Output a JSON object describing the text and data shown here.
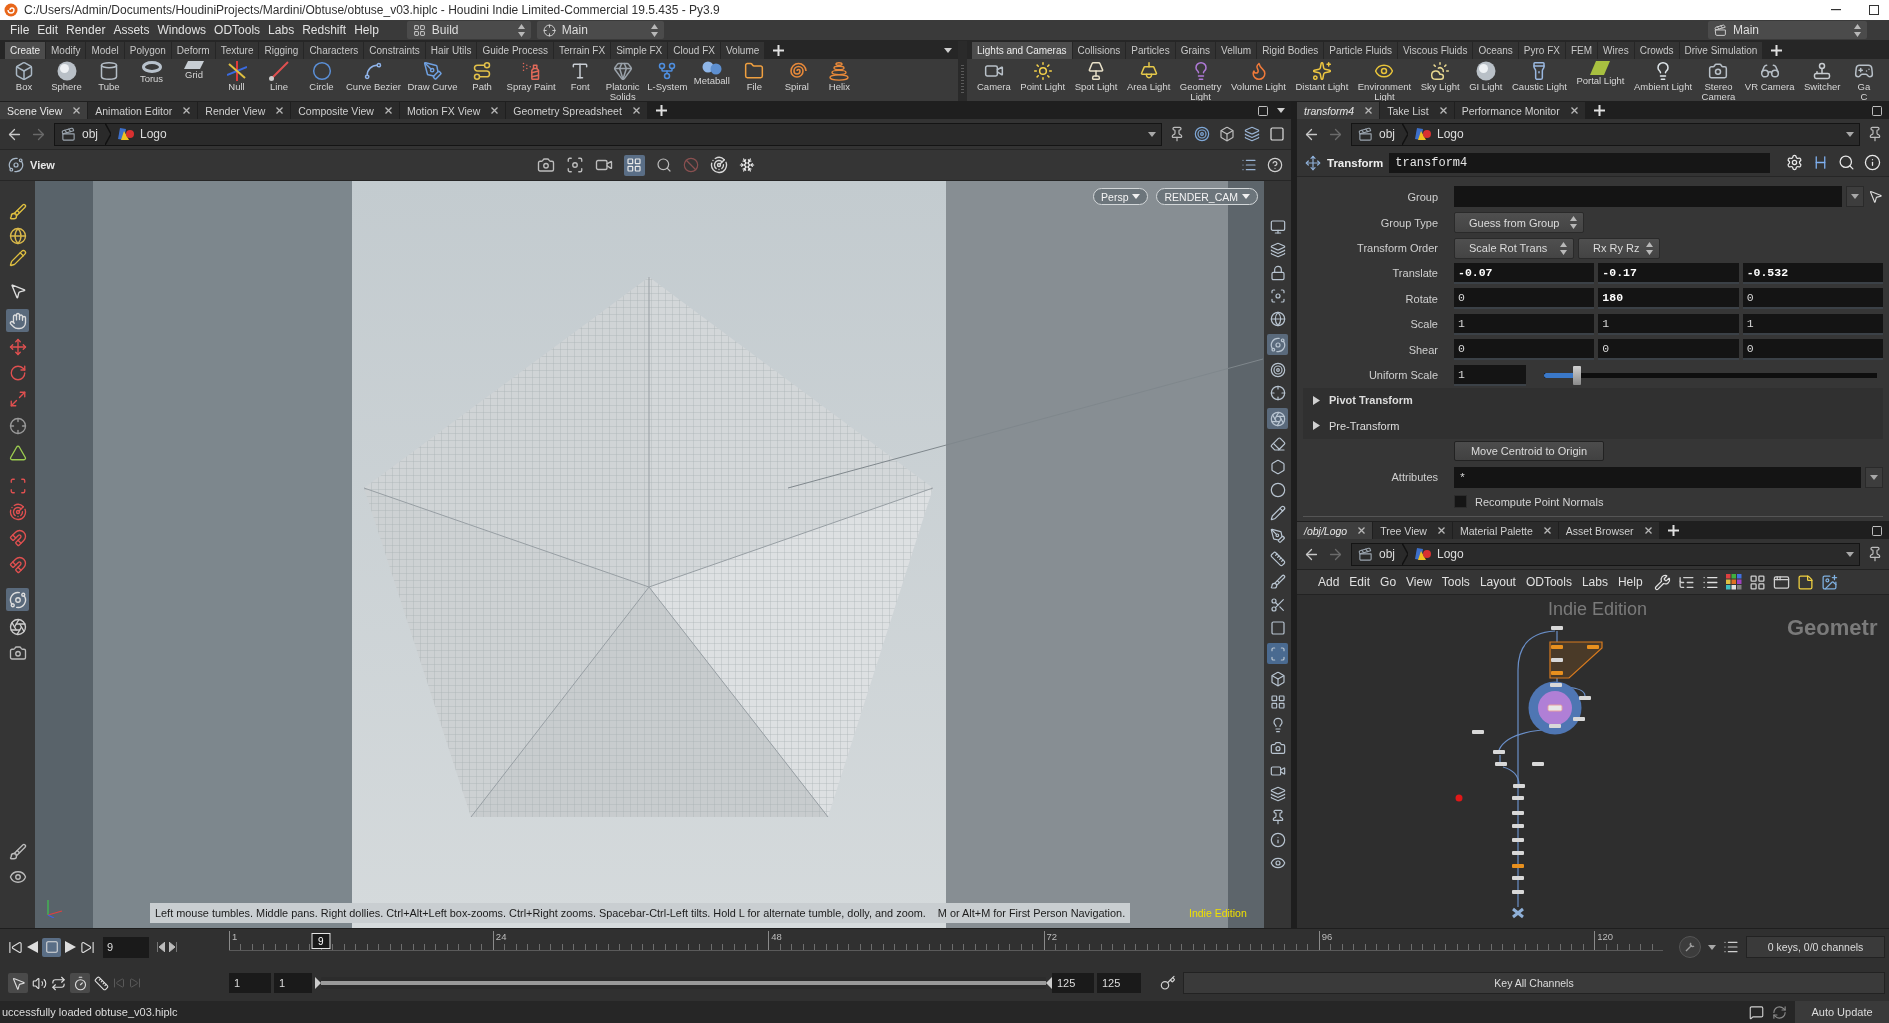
{
  "window": {
    "title": "C:/Users/Admin/Documents/HoudiniProjects/Mardini/Obtuse/obtuse_v03.hiplc - Houdini Indie Limited-Commercial 19.5.435 - Py3.9"
  },
  "menu_bar": {
    "items": [
      "File",
      "Edit",
      "Render",
      "Assets",
      "Windows",
      "ODTools",
      "Labs",
      "Redshift",
      "Help"
    ],
    "desktop": "Build",
    "layout": "Main",
    "right_layout": "Main"
  },
  "shelves": [
    {
      "tabs": [
        {
          "label": "Create",
          "selected": true
        },
        {
          "label": "Modify",
          "selected": false
        },
        {
          "label": "Model",
          "selected": false
        },
        {
          "label": "Polygon",
          "selected": false
        },
        {
          "label": "Deform",
          "selected": false
        },
        {
          "label": "Texture",
          "selected": false
        },
        {
          "label": "Rigging",
          "selected": false
        },
        {
          "label": "Characters",
          "selected": false
        },
        {
          "label": "Constraints",
          "selected": false
        },
        {
          "label": "Hair Utils",
          "selected": false
        },
        {
          "label": "Guide Process",
          "selected": false
        },
        {
          "label": "Terrain FX",
          "selected": false
        },
        {
          "label": "Simple FX",
          "selected": false
        },
        {
          "label": "Cloud FX",
          "selected": false
        },
        {
          "label": "Volume",
          "selected": false
        }
      ],
      "tools": [
        {
          "label": "Box",
          "kind": "box"
        },
        {
          "label": "Sphere",
          "kind": "sphere"
        },
        {
          "label": "Tube",
          "kind": "tube"
        },
        {
          "label": "Torus",
          "kind": "torus"
        },
        {
          "label": "Grid",
          "kind": "grid"
        },
        {
          "label": "Null",
          "kind": "null"
        },
        {
          "label": "Line",
          "kind": "line"
        },
        {
          "label": "Circle",
          "kind": "circle"
        },
        {
          "label": "Curve Bezier",
          "kind": "bezier"
        },
        {
          "label": "Draw Curve",
          "kind": "draw"
        },
        {
          "label": "Path",
          "kind": "path"
        },
        {
          "label": "Spray Paint",
          "kind": "spray"
        },
        {
          "label": "Font",
          "kind": "font"
        },
        {
          "label": "Platonic\nSolids",
          "kind": "platonic"
        },
        {
          "label": "L-System",
          "kind": "lsystem"
        },
        {
          "label": "Metaball",
          "kind": "metaball"
        },
        {
          "label": "File",
          "kind": "file"
        },
        {
          "label": "Spiral",
          "kind": "spiral"
        },
        {
          "label": "Helix",
          "kind": "helix"
        }
      ]
    },
    {
      "tabs": [
        {
          "label": "Lights and Cameras",
          "selected": true
        },
        {
          "label": "Collisions",
          "selected": false
        },
        {
          "label": "Particles",
          "selected": false
        },
        {
          "label": "Grains",
          "selected": false
        },
        {
          "label": "Vellum",
          "selected": false
        },
        {
          "label": "Rigid Bodies",
          "selected": false
        },
        {
          "label": "Particle Fluids",
          "selected": false
        },
        {
          "label": "Viscous Fluids",
          "selected": false
        },
        {
          "label": "Oceans",
          "selected": false
        },
        {
          "label": "Pyro FX",
          "selected": false
        },
        {
          "label": "FEM",
          "selected": false
        },
        {
          "label": "Wires",
          "selected": false
        },
        {
          "label": "Crowds",
          "selected": false
        },
        {
          "label": "Drive Simulation",
          "selected": false
        }
      ],
      "tools": [
        {
          "label": "Camera",
          "kind": "camera"
        },
        {
          "label": "Point Light",
          "kind": "pointlight"
        },
        {
          "label": "Spot Light",
          "kind": "spotlight"
        },
        {
          "label": "Area Light",
          "kind": "arealight"
        },
        {
          "label": "Geometry\nLight",
          "kind": "geolight"
        },
        {
          "label": "Volume Light",
          "kind": "volumelight"
        },
        {
          "label": "Distant Light",
          "kind": "distantlight"
        },
        {
          "label": "Environment\nLight",
          "kind": "envlight"
        },
        {
          "label": "Sky Light",
          "kind": "skylight"
        },
        {
          "label": "GI Light",
          "kind": "gilight"
        },
        {
          "label": "Caustic Light",
          "kind": "causticlight"
        },
        {
          "label": "Portal Light",
          "kind": "portallight"
        },
        {
          "label": "Ambient Light",
          "kind": "ambientlight"
        },
        {
          "label": "Stereo\nCamera",
          "kind": "stereocamera"
        },
        {
          "label": "VR Camera",
          "kind": "vrcamera"
        },
        {
          "label": "Switcher",
          "kind": "switcher"
        },
        {
          "label": "Ga\nC",
          "kind": "gamepad"
        }
      ]
    }
  ],
  "scene_pane": {
    "tabs": [
      {
        "label": "Scene View",
        "selected": true
      },
      {
        "label": "Animation Editor",
        "selected": false
      },
      {
        "label": "Render View",
        "selected": false
      },
      {
        "label": "Composite View",
        "selected": false
      },
      {
        "label": "Motion FX View",
        "selected": false
      },
      {
        "label": "Geometry Spreadsheet",
        "selected": false
      }
    ],
    "path": [
      "obj",
      "Logo"
    ],
    "viewport": {
      "title": "View",
      "menus": [
        "Persp",
        "RENDER_CAM"
      ],
      "hints": [
        "Left mouse tumbles. Middle pans. Right dollies. Ctrl+Alt+Left box-zooms. Ctrl+Right zooms. Spacebar-Ctrl-Left tilts. Hold L for alternate tumble, dolly, and zoom.",
        "M or Alt+M for First Person Navigation."
      ],
      "edition": "Indie Edition"
    }
  },
  "parameters_pane": {
    "tabs": [
      {
        "label": "transform4",
        "selected": true
      },
      {
        "label": "Take List",
        "selected": false
      },
      {
        "label": "Performance Monitor",
        "selected": false
      }
    ],
    "path": [
      "obj",
      "Logo"
    ],
    "node_type": "Transform",
    "node_name": "transform4",
    "rows": [
      {
        "kind": "string",
        "label": "Group",
        "picker": true
      },
      {
        "kind": "menu",
        "label": "Group Type",
        "values": [
          "Guess from Group"
        ]
      },
      {
        "kind": "menu",
        "label": "Transform Order",
        "values": [
          "Scale Rot Trans",
          "Rx Ry Rz"
        ]
      },
      {
        "kind": "vector",
        "label": "Translate",
        "values": [
          {
            "text": "-0.07",
            "modified": true
          },
          {
            "text": "-0.17",
            "modified": true
          },
          {
            "text": "-0.532",
            "modified": true
          }
        ]
      },
      {
        "kind": "vector",
        "label": "Rotate",
        "values": [
          {
            "text": "0",
            "modified": false
          },
          {
            "text": "180",
            "modified": true
          },
          {
            "text": "0",
            "modified": false
          }
        ]
      },
      {
        "kind": "vector",
        "label": "Scale",
        "values": [
          {
            "text": "1",
            "modified": false
          },
          {
            "text": "1",
            "modified": false
          },
          {
            "text": "1",
            "modified": false
          }
        ]
      },
      {
        "kind": "vector",
        "label": "Shear",
        "values": [
          {
            "text": "0",
            "modified": false
          },
          {
            "text": "0",
            "modified": false
          },
          {
            "text": "0",
            "modified": false
          }
        ]
      },
      {
        "kind": "slider",
        "label": "Uniform Scale",
        "value": "1",
        "level": 0.1
      },
      {
        "kind": "folder",
        "label": "Pivot Transform",
        "expanded": false,
        "modified": true
      },
      {
        "kind": "folder",
        "label": "Pre-Transform",
        "expanded": false,
        "modified": false
      },
      {
        "kind": "button",
        "label": "Move Centroid to Origin"
      },
      {
        "kind": "string",
        "label": "Attributes",
        "value": "*"
      },
      {
        "kind": "toggle",
        "label": "Recompute Point Normals",
        "checked": false
      }
    ]
  },
  "network_pane": {
    "tabs": [
      {
        "label": "/obj/Logo",
        "selected": true
      },
      {
        "label": "Tree View",
        "selected": false
      },
      {
        "label": "Material Palette",
        "selected": false
      },
      {
        "label": "Asset Browser",
        "selected": false
      }
    ],
    "path": [
      "obj",
      "Logo"
    ],
    "menu": [
      "Add",
      "Edit",
      "Go",
      "View",
      "Tools",
      "Layout",
      "ODTools",
      "Labs",
      "Help"
    ],
    "watermark": "Indie Edition",
    "context": "Geometr"
  },
  "timeline": {
    "frame": "9",
    "playhead": "9",
    "level": 0.064,
    "ticks": [
      "1",
      "24",
      "48",
      "72",
      "96",
      "120"
    ],
    "range": [
      "1",
      "1",
      "125",
      "125"
    ],
    "range_bar": {
      "level": 1
    },
    "keys_info": "0 keys, 0/0 channels",
    "key_button": "Key All Channels"
  },
  "status_bar": {
    "message": "uccessfully loaded obtuse_v03.hiplc",
    "update_mode": "Auto Update"
  }
}
